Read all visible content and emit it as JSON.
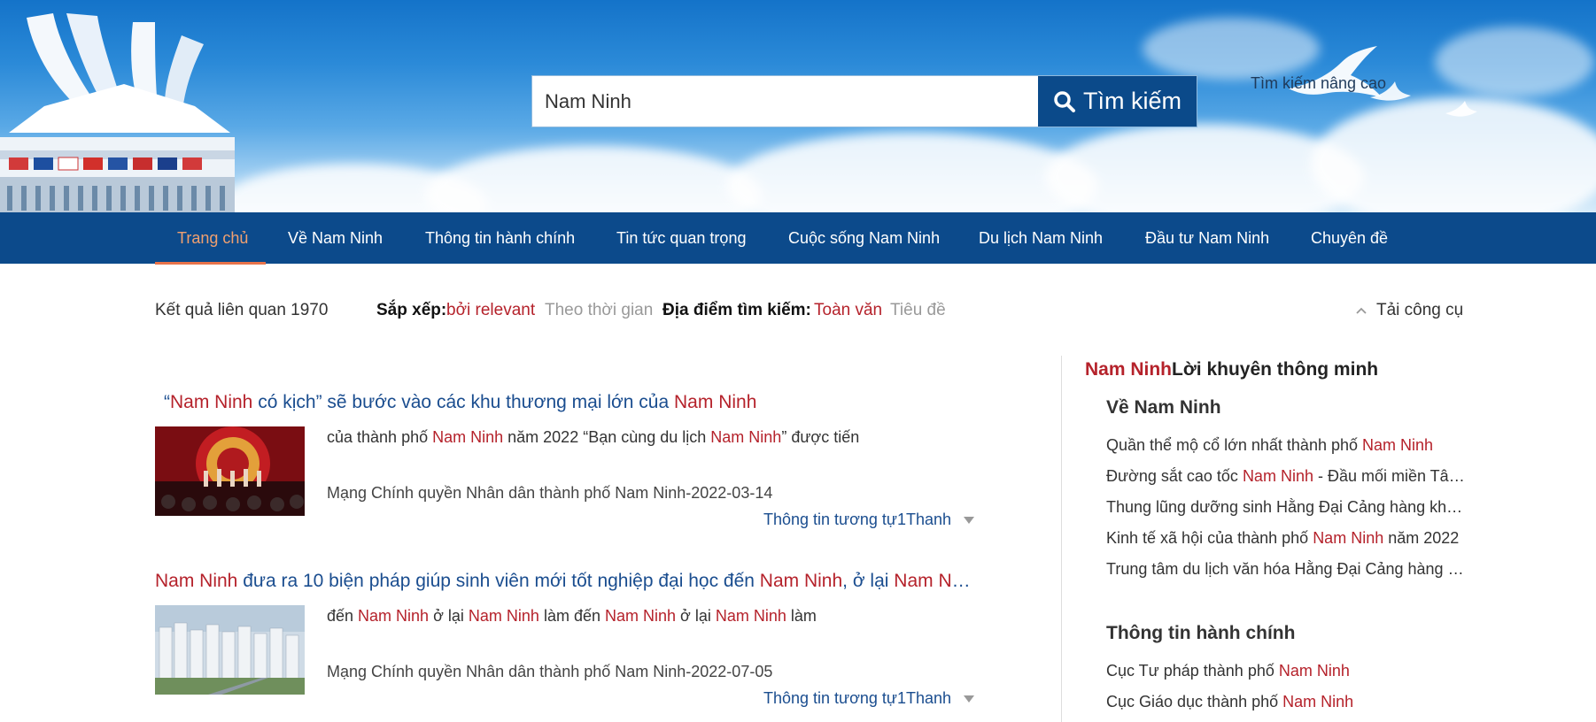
{
  "search": {
    "value": "Nam Ninh",
    "button_label": "Tìm kiếm",
    "advanced_label": "Tìm kiếm nâng cao"
  },
  "nav": {
    "items": [
      {
        "label": "Trang chủ"
      },
      {
        "label": "Về Nam Ninh"
      },
      {
        "label": "Thông tin hành chính"
      },
      {
        "label": "Tin tức quan trọng"
      },
      {
        "label": "Cuộc sống Nam Ninh"
      },
      {
        "label": "Du lịch Nam Ninh"
      },
      {
        "label": "Đầu tư Nam Ninh"
      },
      {
        "label": "Chuyên đề"
      }
    ]
  },
  "toolbar": {
    "result_count": "Kết quả liên quan 1970",
    "sort_label": "Sắp xếp:",
    "sort_relevant": "bởi relevant",
    "sort_time": "Theo thời gian",
    "location_label": "Địa điểm tìm kiếm:",
    "location_full": "Toàn văn",
    "location_title": "Tiêu đề",
    "tools_label": "Tải công cụ"
  },
  "results": [
    {
      "title_parts": [
        {
          "text": "“",
          "hl": false
        },
        {
          "text": "Nam Ninh",
          "hl": true
        },
        {
          "text": " có kịch” sẽ bước vào các khu thương mại lớn của ",
          "hl": false
        },
        {
          "text": "Nam Ninh",
          "hl": true
        }
      ],
      "snippet_parts": [
        {
          "text": "của thành phố ",
          "hl": false
        },
        {
          "text": "Nam Ninh",
          "hl": true
        },
        {
          "text": " năm 2022 “Bạn cùng du lịch ",
          "hl": false
        },
        {
          "text": "Nam Ninh",
          "hl": true
        },
        {
          "text": "” được tiến",
          "hl": false
        }
      ],
      "source": "Mạng Chính quyền Nhân dân thành phố Nam Ninh-2022-03-14",
      "similar": "Thông tin tương tự1Thanh"
    },
    {
      "title_parts": [
        {
          "text": "Nam Ninh",
          "hl": true
        },
        {
          "text": " đưa ra 10 biện pháp giúp sinh viên mới tốt nghiệp đại học đến ",
          "hl": false
        },
        {
          "text": "Nam Ninh",
          "hl": true
        },
        {
          "text": ", ở lại ",
          "hl": false
        },
        {
          "text": "Nam Ninh",
          "hl": true
        }
      ],
      "snippet_parts": [
        {
          "text": "đến ",
          "hl": false
        },
        {
          "text": "Nam Ninh",
          "hl": true
        },
        {
          "text": " ở lại ",
          "hl": false
        },
        {
          "text": "Nam Ninh",
          "hl": true
        },
        {
          "text": " làm đến ",
          "hl": false
        },
        {
          "text": "Nam Ninh",
          "hl": true
        },
        {
          "text": " ở lại ",
          "hl": false
        },
        {
          "text": "Nam Ninh",
          "hl": true
        },
        {
          "text": " làm",
          "hl": false
        }
      ],
      "source": "Mạng Chính quyền Nhân dân thành phố Nam Ninh-2022-07-05",
      "similar": "Thông tin tương tự1Thanh"
    }
  ],
  "sidebar": {
    "heading_highlight": "Nam Ninh",
    "heading_rest": "Lời khuyên thông minh",
    "sections": [
      {
        "title": "Về Nam Ninh",
        "links": [
          [
            {
              "text": "Quần thể mộ cổ lớn nhất thành phố ",
              "hl": false
            },
            {
              "text": "Nam Ninh",
              "hl": true
            }
          ],
          [
            {
              "text": "Đường sắt cao tốc ",
              "hl": false
            },
            {
              "text": "Nam Ninh",
              "hl": true
            },
            {
              "text": " - Đầu mối miền Tây Nam",
              "hl": false
            }
          ],
          [
            {
              "text": "Thung lũng dưỡng sinh Hằng Đại Cảng hàng không",
              "hl": false
            }
          ],
          [
            {
              "text": "Kinh tế xã hội của thành phố ",
              "hl": false
            },
            {
              "text": "Nam Ninh",
              "hl": true
            },
            {
              "text": " năm 2022",
              "hl": false
            }
          ],
          [
            {
              "text": "Trung tâm du lịch văn hóa Hằng Đại Cảng hàng không",
              "hl": false
            }
          ]
        ]
      },
      {
        "title": "Thông tin hành chính",
        "links": [
          [
            {
              "text": "Cục Tư pháp thành phố ",
              "hl": false
            },
            {
              "text": "Nam Ninh",
              "hl": true
            }
          ],
          [
            {
              "text": "Cục Giáo dục thành phố ",
              "hl": false
            },
            {
              "text": "Nam Ninh",
              "hl": true
            }
          ]
        ]
      }
    ]
  },
  "colors": {
    "nav_bg": "#0c4a8b",
    "highlight": "#b5222b",
    "link": "#1a4d8f",
    "active_nav": "#f0a070"
  }
}
